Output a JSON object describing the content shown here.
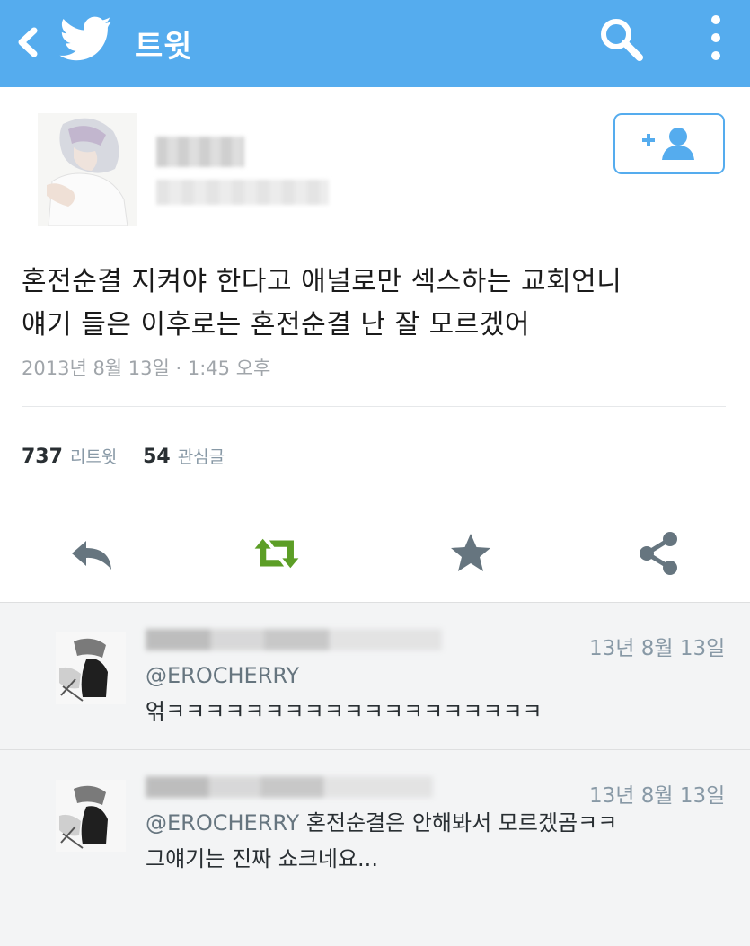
{
  "topbar": {
    "title": "트윗",
    "background": "#55acee"
  },
  "tweet": {
    "text_line1": "혼전순결 지켜야 한다고 애널로만 섹스하는 교회언니",
    "text_line2": "얘기 들은 이후로는 혼전순결 난 잘 모르겠어",
    "timestamp": "2013년 8월 13일 · 1:45 오후",
    "retweet_count": "737",
    "retweet_label": "리트윗",
    "favorite_count": "54",
    "favorite_label": "관심글"
  },
  "actions": {
    "reply_icon": "reply-icon",
    "retweet_icon": "retweet-icon",
    "retweet_color": "#5c9e26",
    "favorite_icon": "star-icon",
    "share_icon": "share-icon",
    "icon_color": "#66757f"
  },
  "replies": [
    {
      "date": "13년 8월 13일",
      "mention": "@EROCHERRY",
      "line1": "",
      "line2": "얶ㅋㅋㅋㅋㅋㅋㅋㅋㅋㅋㅋㅋㅋㅋㅋㅋㅋㅋㅋ"
    },
    {
      "date": "13년 8월 13일",
      "mention": "@EROCHERRY",
      "line1": " 혼전순결은 안해봐서 모르겠곰ㅋㅋ",
      "line2": "그얘기는 진짜 쇼크네요..."
    }
  ]
}
